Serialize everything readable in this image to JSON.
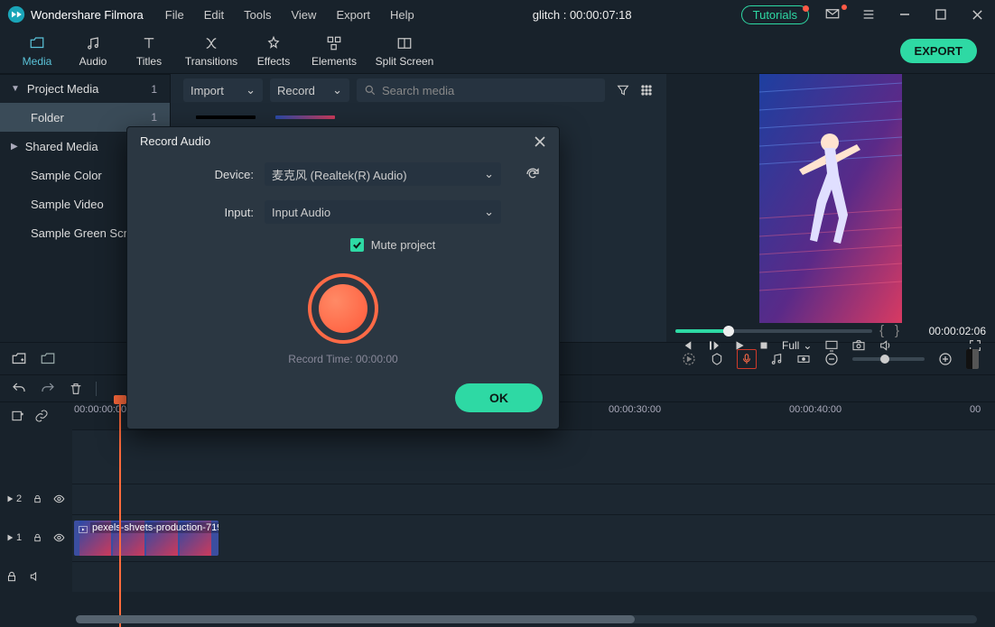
{
  "titlebar": {
    "appname": "Wondershare Filmora",
    "menus": [
      "File",
      "Edit",
      "Tools",
      "View",
      "Export",
      "Help"
    ],
    "document_title": "glitch : 00:00:07:18",
    "tutorials_label": "Tutorials"
  },
  "tabs": {
    "items": [
      {
        "label": "Media"
      },
      {
        "label": "Audio"
      },
      {
        "label": "Titles"
      },
      {
        "label": "Transitions"
      },
      {
        "label": "Effects"
      },
      {
        "label": "Elements"
      },
      {
        "label": "Split Screen"
      }
    ],
    "export_label": "EXPORT"
  },
  "sidebar": {
    "project_media": "Project Media",
    "project_media_count": "1",
    "folder": "Folder",
    "folder_count": "1",
    "shared_media": "Shared Media",
    "sample_color": "Sample Color",
    "sample_video": "Sample Video",
    "sample_green": "Sample Green Scree"
  },
  "media_toolbar": {
    "import_label": "Import",
    "record_label": "Record",
    "search_placeholder": "Search media"
  },
  "preview": {
    "timecode": "00:00:02:06",
    "quality": "Full"
  },
  "timeline": {
    "ruler_t0": "00:00:00:00",
    "ruler_t1": "00:00:30:00",
    "ruler_t2": "00:00:40:00",
    "ruler_t3": "00",
    "track2_icon": "2",
    "track1_icon": "1",
    "clip_label": "pexels-shvets-production-719"
  },
  "modal": {
    "title": "Record Audio",
    "device_label": "Device:",
    "device_value": "麦克风 (Realtek(R) Audio)",
    "input_label": "Input:",
    "input_value": "Input Audio",
    "mute_label": "Mute project",
    "rec_time_label": "Record Time: 00:00:00",
    "ok_label": "OK"
  }
}
